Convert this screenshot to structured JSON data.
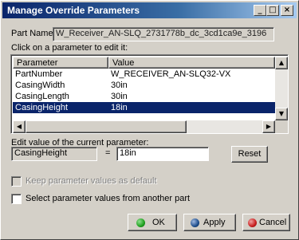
{
  "window": {
    "title": "Manage Override Parameters"
  },
  "titlebar_buttons": {
    "minimize": "_",
    "maximize": "□",
    "close": "×"
  },
  "part": {
    "label": "Part Name:",
    "value": "W_Receiver_AN-SLQ_2731778b_dc_3cd1ca9e_3196"
  },
  "list": {
    "caption": "Click on a parameter to edit it:",
    "headers": [
      "Parameter",
      "Value"
    ],
    "rows": [
      {
        "parameter": "PartNumber",
        "value": "W_RECEIVER_AN-SLQ32-VX"
      },
      {
        "parameter": "CasingWidth",
        "value": "30in"
      },
      {
        "parameter": "CasingLength",
        "value": "30in"
      },
      {
        "parameter": "CasingHeight",
        "value": "18in",
        "selected": true
      }
    ]
  },
  "scroll": {
    "up": "▲",
    "down": "▼",
    "left": "◀",
    "right": "▶"
  },
  "edit": {
    "caption": "Edit value of the current parameter:",
    "parameter": "CasingHeight",
    "equals": "=",
    "value": "18in",
    "reset_label": "Reset"
  },
  "options": {
    "keep_default": {
      "label": "Keep parameter values as default",
      "checked": false,
      "enabled": false
    },
    "from_other_part": {
      "label": "Select parameter values from another part",
      "checked": false,
      "enabled": true
    }
  },
  "buttons": {
    "ok": "OK",
    "apply": "Apply",
    "cancel": "Cancel"
  },
  "colors": {
    "ok": "#1fa01f",
    "apply": "#1e4e8c",
    "cancel": "#c81e1e",
    "selection": "#0a246a"
  }
}
